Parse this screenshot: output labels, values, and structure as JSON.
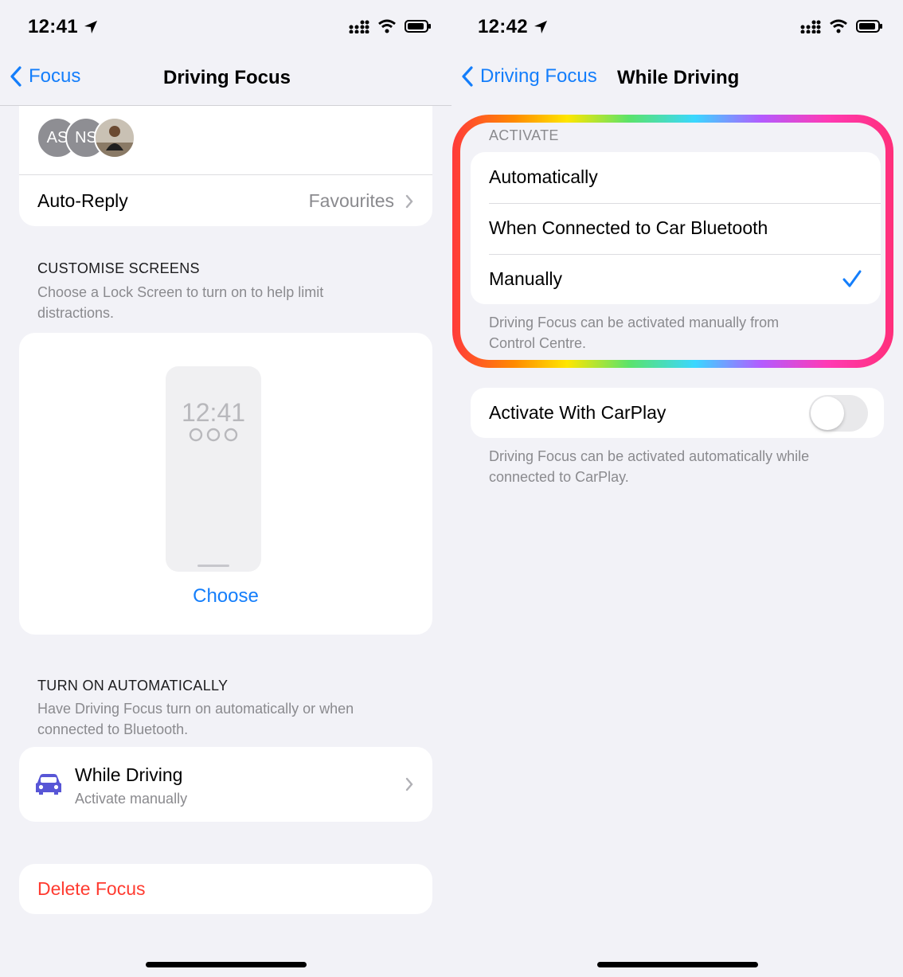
{
  "left": {
    "status": {
      "time": "12:41"
    },
    "nav": {
      "back_label": "Focus",
      "title": "Driving Focus"
    },
    "people": {
      "avatars": [
        {
          "initials": "AS",
          "color": "#8e8e93"
        },
        {
          "initials": "NS",
          "color": "#8e8e93"
        },
        {
          "initials": "",
          "color": "#6b4a32"
        }
      ]
    },
    "auto_reply": {
      "label": "Auto-Reply",
      "value": "Favourites"
    },
    "customise": {
      "header": "CUSTOMISE SCREENS",
      "sub_line1": "Choose a Lock Screen to turn on to help limit",
      "sub_line2": "distractions.",
      "preview_time": "12:41",
      "choose_label": "Choose"
    },
    "turn_on": {
      "header": "TURN ON AUTOMATICALLY",
      "sub_line1": "Have Driving Focus turn on automatically or when",
      "sub_line2": "connected to Bluetooth.",
      "item_title": "While Driving",
      "item_subtitle": "Activate manually",
      "car_color": "#5856d6"
    },
    "delete_label": "Delete Focus"
  },
  "right": {
    "status": {
      "time": "12:42"
    },
    "nav": {
      "back_label": "Driving Focus",
      "title": "While Driving"
    },
    "activate": {
      "header": "ACTIVATE",
      "options": [
        "Automatically",
        "When Connected to Car Bluetooth",
        "Manually"
      ],
      "selected": "Manually",
      "footer_line1": "Driving Focus can be activated manually from",
      "footer_line2": "Control Centre."
    },
    "carplay": {
      "label": "Activate With CarPlay",
      "enabled": false,
      "footer_line1": "Driving Focus can be activated automatically while",
      "footer_line2": "connected to CarPlay."
    }
  },
  "colors": {
    "accent": "#147efb",
    "destructive": "#ff3b30",
    "background": "#f2f2f7"
  }
}
